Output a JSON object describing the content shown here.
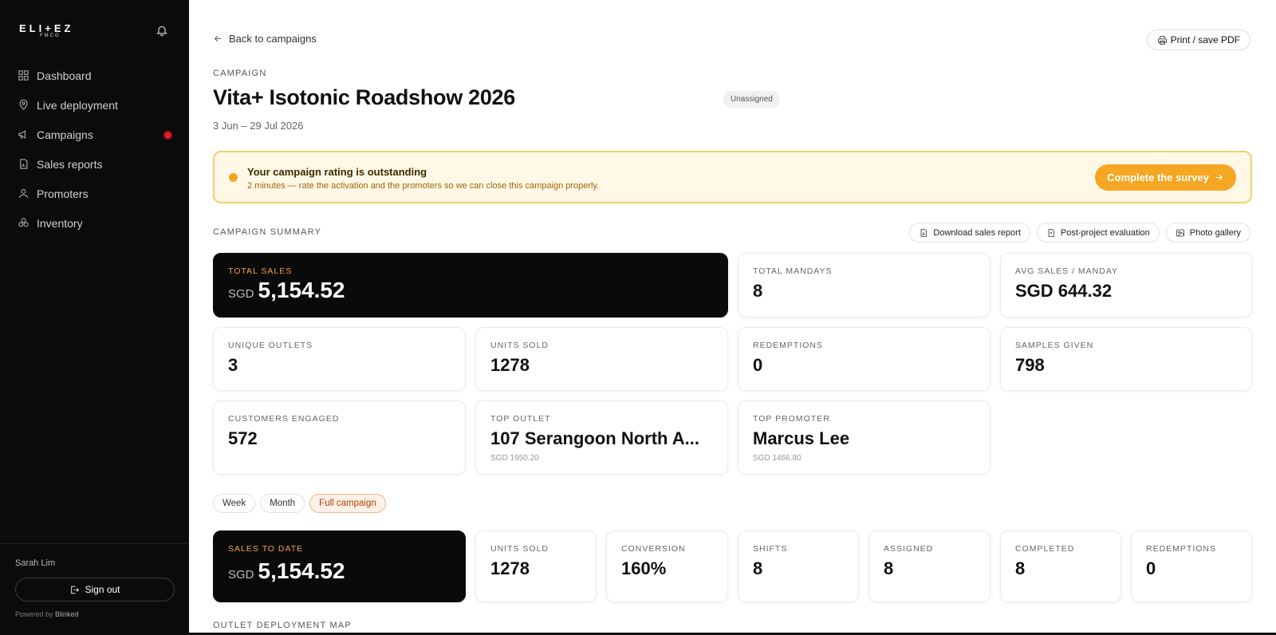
{
  "sidebar": {
    "logo_main": "ELI+EZ",
    "logo_sub": "FMCG",
    "nav": [
      {
        "label": "Dashboard",
        "icon": "dashboard-icon"
      },
      {
        "label": "Live deployment",
        "icon": "map-pin-icon"
      },
      {
        "label": "Campaigns",
        "icon": "megaphone-icon",
        "has_alert": true
      },
      {
        "label": "Sales reports",
        "icon": "file-report-icon"
      },
      {
        "label": "Promoters",
        "icon": "user-icon"
      },
      {
        "label": "Inventory",
        "icon": "boxes-icon"
      }
    ],
    "user_name": "Sarah Lim",
    "signout_label": "Sign out",
    "powered_prefix": "Powered by",
    "powered_brand": "Blinked"
  },
  "header": {
    "back_label": "Back to campaigns",
    "print_label": "Print / save PDF",
    "eyebrow": "CAMPAIGN",
    "title": "Vita+ Isotonic Roadshow 2026",
    "status_badge": "Unassigned",
    "dates": "3 Jun – 29 Jul 2026"
  },
  "banner": {
    "title": "Your campaign rating is outstanding",
    "subtitle": "2 minutes — rate the activation and the promoters so we can close this campaign properly.",
    "button_label": "Complete the survey"
  },
  "summary": {
    "heading": "CAMPAIGN SUMMARY",
    "actions": [
      "Download sales report",
      "Post-project evaluation",
      "Photo gallery"
    ],
    "total_sales": {
      "label": "TOTAL SALES",
      "currency": "SGD",
      "value": "5,154.52"
    },
    "total_mandays": {
      "label": "TOTAL MANDAYS",
      "value": "8"
    },
    "avg_sales": {
      "label": "AVG SALES / MANDAY",
      "value": "SGD 644.32"
    },
    "unique_outlets": {
      "label": "UNIQUE OUTLETS",
      "value": "3"
    },
    "units_sold": {
      "label": "UNITS SOLD",
      "value": "1278"
    },
    "redemptions": {
      "label": "REDEMPTIONS",
      "value": "0"
    },
    "samples_given": {
      "label": "SAMPLES GIVEN",
      "value": "798"
    },
    "customers_engaged": {
      "label": "CUSTOMERS ENGAGED",
      "value": "572"
    },
    "top_outlet": {
      "label": "TOP OUTLET",
      "value": "107 Serangoon North A...",
      "sub": "SGD 1950.20"
    },
    "top_promoter": {
      "label": "TOP PROMOTER",
      "value": "Marcus Lee",
      "sub": "SGD 1466.80"
    }
  },
  "period": {
    "options": [
      "Week",
      "Month",
      "Full campaign"
    ],
    "selected": "Full campaign"
  },
  "period_stats": {
    "sales_to_date": {
      "label": "SALES TO DATE",
      "currency": "SGD",
      "value": "5,154.52"
    },
    "units_sold": {
      "label": "UNITS SOLD",
      "value": "1278"
    },
    "conversion": {
      "label": "CONVERSION",
      "value": "160%"
    },
    "shifts": {
      "label": "SHIFTS",
      "value": "8"
    },
    "assigned": {
      "label": "ASSIGNED",
      "value": "8"
    },
    "completed": {
      "label": "COMPLETED",
      "value": "8"
    },
    "redemptions": {
      "label": "REDEMPTIONS",
      "value": "0"
    }
  },
  "map_heading": "OUTLET DEPLOYMENT MAP",
  "colors": {
    "accent": "#f5a623",
    "alert": "#e11d2a",
    "banner_bg": "#fff8e6",
    "sidebar_bg": "#0b0b0b"
  }
}
